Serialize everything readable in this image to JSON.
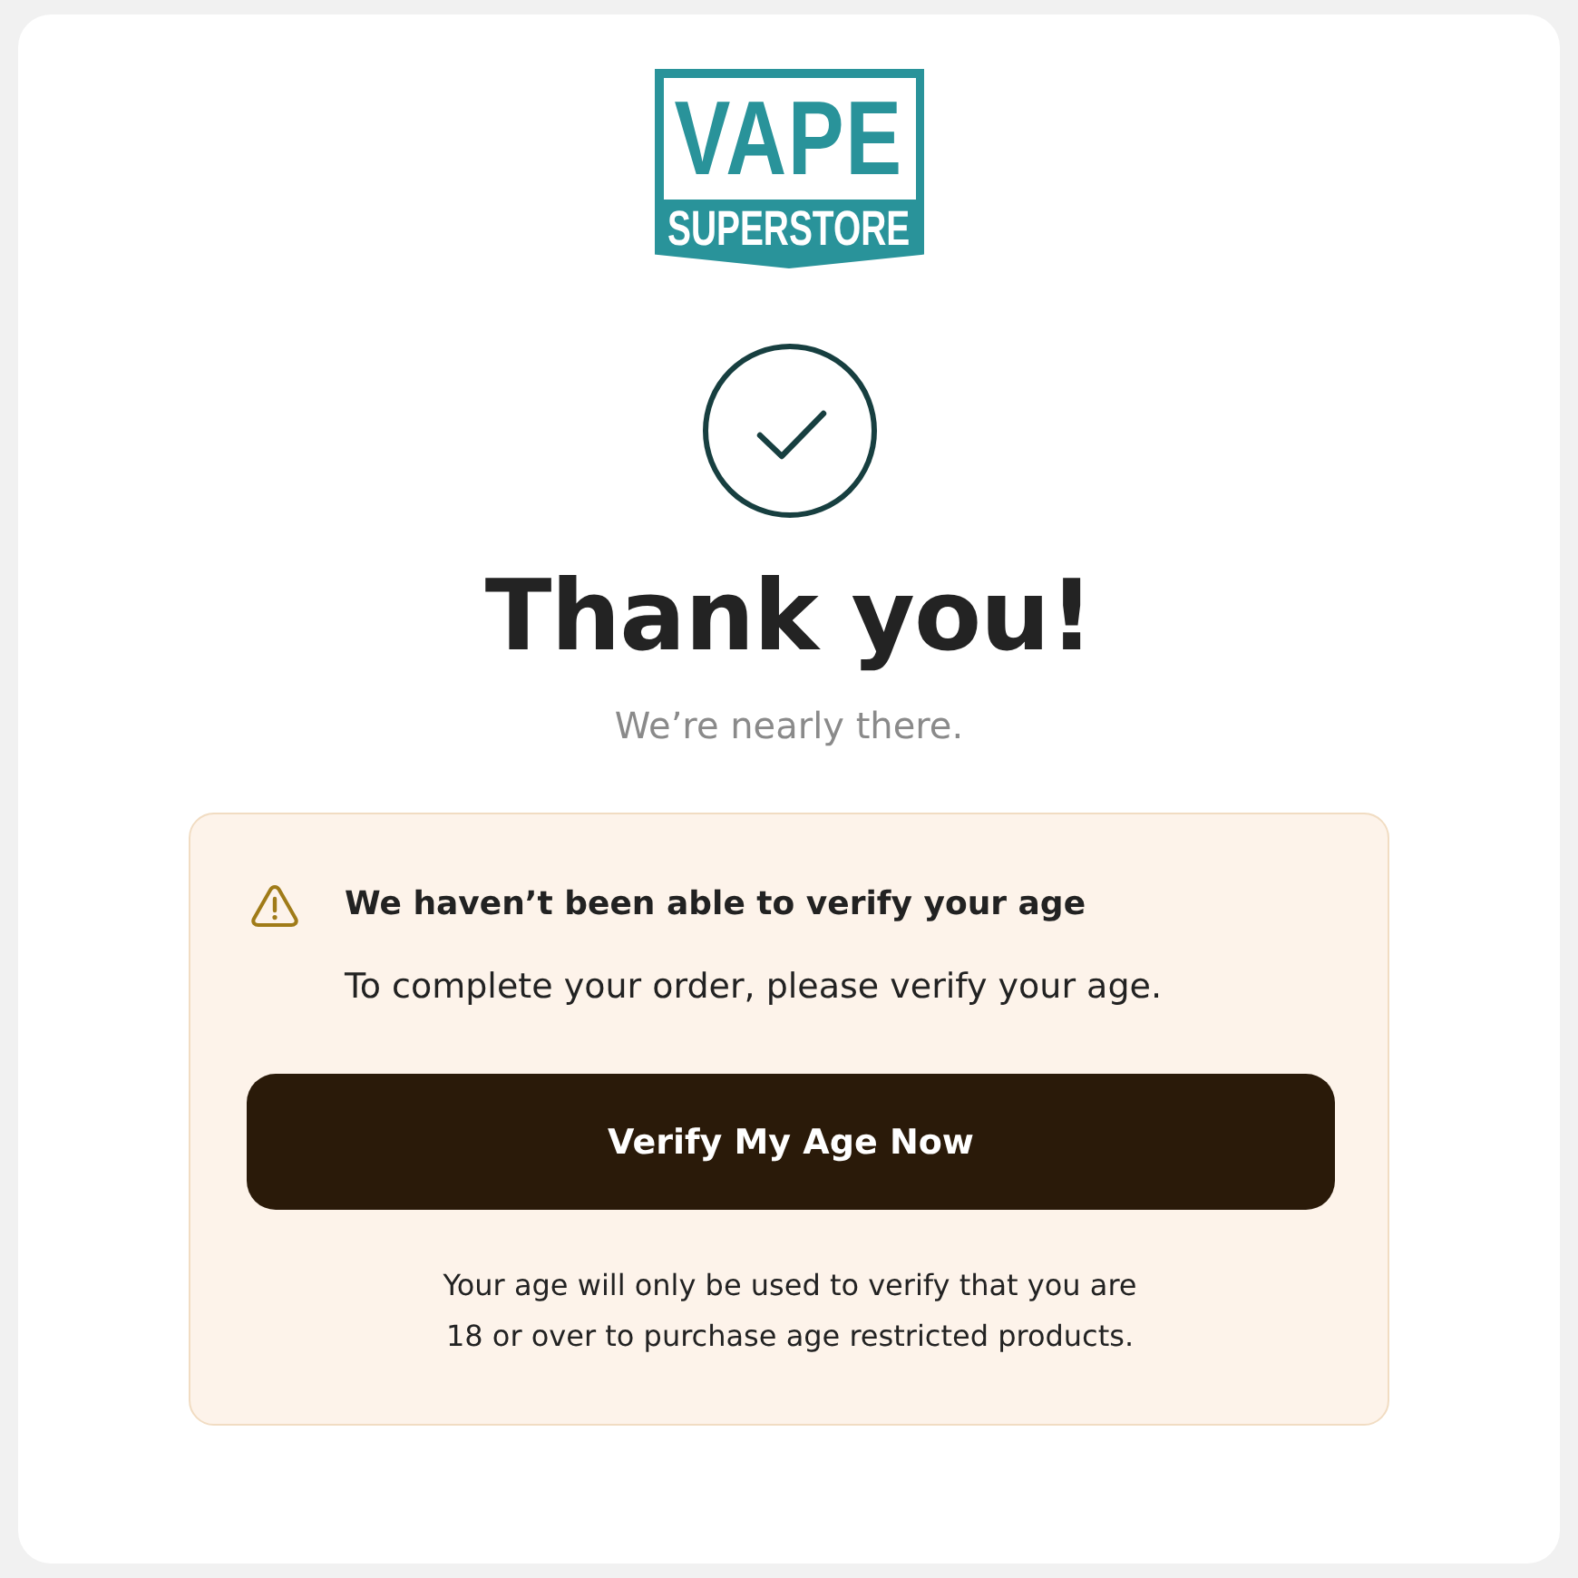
{
  "logo": {
    "line_1": "VAPE",
    "line_2": "SUPERSTORE"
  },
  "title": "Thank you!",
  "subtitle": "We’re nearly there.",
  "notice": {
    "heading": "We haven’t been able to verify your age",
    "message": "To complete your order, please verify your age.",
    "button": "Verify My Age Now",
    "footnote": "Your age will only be used to verify that you are 18 or over to purchase age restricted products."
  }
}
